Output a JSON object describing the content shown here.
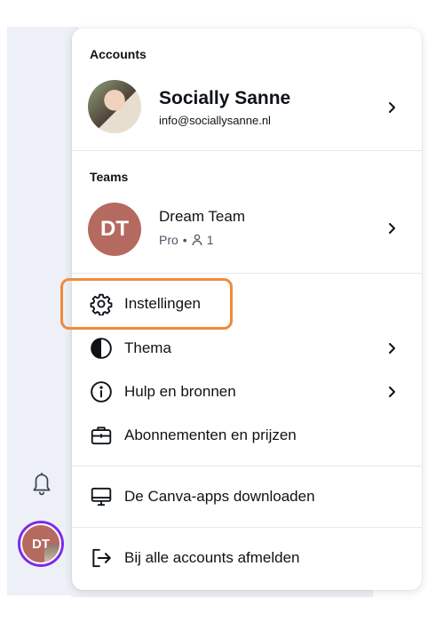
{
  "accounts": {
    "section_label": "Accounts",
    "name": "Socially Sanne",
    "email": "info@sociallysanne.nl"
  },
  "teams": {
    "section_label": "Teams",
    "avatar_initials": "DT",
    "name": "Dream Team",
    "plan": "Pro",
    "separator": "•",
    "member_count": "1"
  },
  "menu": {
    "settings": "Instellingen",
    "theme": "Thema",
    "help": "Hulp en bronnen",
    "subscriptions": "Abonnementen en prijzen",
    "download_apps": "De Canva-apps downloaden",
    "sign_out_all": "Bij alle accounts afmelden"
  },
  "sidebar": {
    "avatar_initials": "DT"
  },
  "colors": {
    "highlight": "#f08a3a",
    "team_avatar": "#b56a5f",
    "avatar_ring": "#7d2ae8",
    "sidebar_bg": "#eef0f8"
  },
  "icons": {
    "bell": "bell-icon",
    "settings": "gear-icon",
    "theme": "contrast-icon",
    "help": "info-circle-icon",
    "subscriptions": "briefcase-icon",
    "download": "monitor-icon",
    "sign_out": "sign-out-icon",
    "members": "person-icon",
    "chevron": "chevron-right-icon"
  }
}
